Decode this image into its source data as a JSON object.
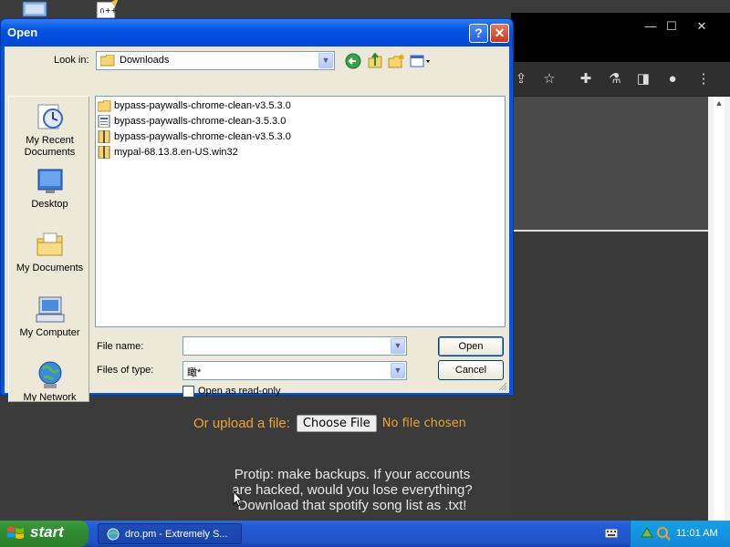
{
  "dialog": {
    "title": "Open",
    "help_label": "?",
    "close_label": "✕",
    "look_in_label": "Look in:",
    "look_in_value": "Downloads",
    "places": [
      {
        "label": "My Recent Documents",
        "icon": "recent-documents-icon"
      },
      {
        "label": "Desktop",
        "icon": "desktop-icon"
      },
      {
        "label": "My Documents",
        "icon": "my-documents-icon"
      },
      {
        "label": "My Computer",
        "icon": "my-computer-icon"
      },
      {
        "label": "My Network",
        "icon": "my-network-icon"
      }
    ],
    "files": [
      {
        "name": "bypass-paywalls-chrome-clean-v3.5.3.0",
        "icon": "folder-icon"
      },
      {
        "name": "bypass-paywalls-chrome-clean-3.5.3.0",
        "icon": "document-icon"
      },
      {
        "name": "bypass-paywalls-chrome-clean-v3.5.3.0",
        "icon": "zip-icon"
      },
      {
        "name": "mypal-68.13.8.en-US.win32",
        "icon": "zip-icon"
      }
    ],
    "file_name_label": "File name:",
    "file_name_value": "",
    "files_of_type_label": "Files of type:",
    "files_of_type_value": "瞰*",
    "open_label": "Open",
    "cancel_label": "Cancel",
    "read_only_label": "Open as read-only"
  },
  "page": {
    "upload_label": "Or upload a file:",
    "choose_file_label": "Choose File",
    "no_file_label": "No file chosen",
    "protip_line1": "Protip: make backups. If your accounts",
    "protip_line2": "are hacked, would you lose everything?",
    "protip_line3": "Download that spotify song list as .txt!"
  },
  "browser": {
    "minimize_label": "—",
    "maximize_label": "☐",
    "close_label": "✕"
  },
  "taskbar": {
    "start_label": "start",
    "task_label": "dro.pm - Extremely S...",
    "clock": "11:01 AM"
  },
  "colors": {
    "xp_title_blue": "#0a52e0",
    "dialog_face": "#ece9d8",
    "page_accent": "#e8a33a",
    "start_green": "#3c9a3c"
  }
}
